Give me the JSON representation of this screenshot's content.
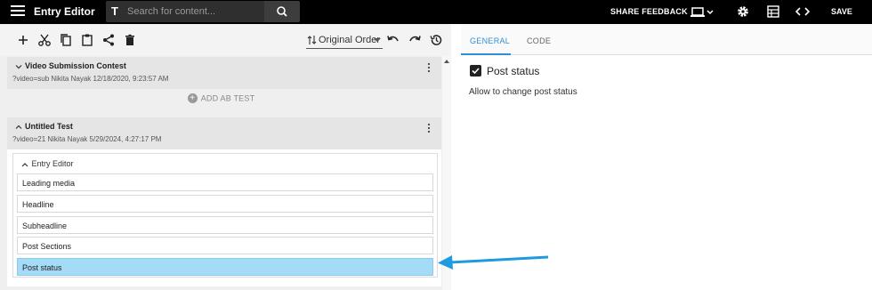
{
  "header": {
    "app_title": "Entry Editor",
    "search_placeholder": "Search for content...",
    "share_feedback": "SHARE FEEDBACK",
    "save": "SAVE"
  },
  "toolbar": {
    "order_label": "Original Order"
  },
  "cards": [
    {
      "title": "Video Submission Contest",
      "meta": "?video=sub Nikita Nayak 12/18/2020, 9:23:57 AM"
    },
    {
      "title": "Untitled Test",
      "meta": "?video=21 Nikita Nayak 5/29/2024, 4:27:17 PM"
    }
  ],
  "ab_test_label": "ADD AB TEST",
  "entry_editor": {
    "header": "Entry Editor",
    "rows": [
      "Leading media",
      "Headline",
      "Subheadline",
      "Post Sections",
      "Post status"
    ],
    "selected_row": "Post status"
  },
  "right_panel": {
    "tabs": [
      "GENERAL",
      "CODE"
    ],
    "active_tab": "GENERAL",
    "title": "Post status",
    "description": "Allow to change post status"
  },
  "colors": {
    "accent": "#2f8fd6",
    "selected_row": "#a4dcf8",
    "arrow": "#1e9be0"
  }
}
